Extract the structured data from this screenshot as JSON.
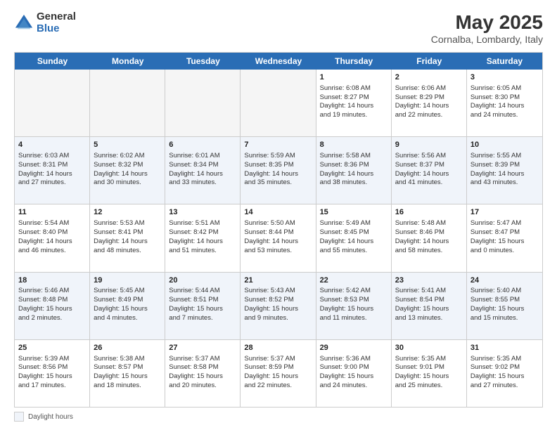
{
  "logo": {
    "general": "General",
    "blue": "Blue"
  },
  "title": "May 2025",
  "subtitle": "Cornalba, Lombardy, Italy",
  "days_of_week": [
    "Sunday",
    "Monday",
    "Tuesday",
    "Wednesday",
    "Thursday",
    "Friday",
    "Saturday"
  ],
  "weeks": [
    [
      {
        "day": "",
        "info": "",
        "empty": true
      },
      {
        "day": "",
        "info": "",
        "empty": true
      },
      {
        "day": "",
        "info": "",
        "empty": true
      },
      {
        "day": "",
        "info": "",
        "empty": true
      },
      {
        "day": "1",
        "info": "Sunrise: 6:08 AM\nSunset: 8:27 PM\nDaylight: 14 hours\nand 19 minutes.",
        "empty": false
      },
      {
        "day": "2",
        "info": "Sunrise: 6:06 AM\nSunset: 8:29 PM\nDaylight: 14 hours\nand 22 minutes.",
        "empty": false
      },
      {
        "day": "3",
        "info": "Sunrise: 6:05 AM\nSunset: 8:30 PM\nDaylight: 14 hours\nand 24 minutes.",
        "empty": false
      }
    ],
    [
      {
        "day": "4",
        "info": "Sunrise: 6:03 AM\nSunset: 8:31 PM\nDaylight: 14 hours\nand 27 minutes.",
        "empty": false
      },
      {
        "day": "5",
        "info": "Sunrise: 6:02 AM\nSunset: 8:32 PM\nDaylight: 14 hours\nand 30 minutes.",
        "empty": false
      },
      {
        "day": "6",
        "info": "Sunrise: 6:01 AM\nSunset: 8:34 PM\nDaylight: 14 hours\nand 33 minutes.",
        "empty": false
      },
      {
        "day": "7",
        "info": "Sunrise: 5:59 AM\nSunset: 8:35 PM\nDaylight: 14 hours\nand 35 minutes.",
        "empty": false
      },
      {
        "day": "8",
        "info": "Sunrise: 5:58 AM\nSunset: 8:36 PM\nDaylight: 14 hours\nand 38 minutes.",
        "empty": false
      },
      {
        "day": "9",
        "info": "Sunrise: 5:56 AM\nSunset: 8:37 PM\nDaylight: 14 hours\nand 41 minutes.",
        "empty": false
      },
      {
        "day": "10",
        "info": "Sunrise: 5:55 AM\nSunset: 8:39 PM\nDaylight: 14 hours\nand 43 minutes.",
        "empty": false
      }
    ],
    [
      {
        "day": "11",
        "info": "Sunrise: 5:54 AM\nSunset: 8:40 PM\nDaylight: 14 hours\nand 46 minutes.",
        "empty": false
      },
      {
        "day": "12",
        "info": "Sunrise: 5:53 AM\nSunset: 8:41 PM\nDaylight: 14 hours\nand 48 minutes.",
        "empty": false
      },
      {
        "day": "13",
        "info": "Sunrise: 5:51 AM\nSunset: 8:42 PM\nDaylight: 14 hours\nand 51 minutes.",
        "empty": false
      },
      {
        "day": "14",
        "info": "Sunrise: 5:50 AM\nSunset: 8:44 PM\nDaylight: 14 hours\nand 53 minutes.",
        "empty": false
      },
      {
        "day": "15",
        "info": "Sunrise: 5:49 AM\nSunset: 8:45 PM\nDaylight: 14 hours\nand 55 minutes.",
        "empty": false
      },
      {
        "day": "16",
        "info": "Sunrise: 5:48 AM\nSunset: 8:46 PM\nDaylight: 14 hours\nand 58 minutes.",
        "empty": false
      },
      {
        "day": "17",
        "info": "Sunrise: 5:47 AM\nSunset: 8:47 PM\nDaylight: 15 hours\nand 0 minutes.",
        "empty": false
      }
    ],
    [
      {
        "day": "18",
        "info": "Sunrise: 5:46 AM\nSunset: 8:48 PM\nDaylight: 15 hours\nand 2 minutes.",
        "empty": false
      },
      {
        "day": "19",
        "info": "Sunrise: 5:45 AM\nSunset: 8:49 PM\nDaylight: 15 hours\nand 4 minutes.",
        "empty": false
      },
      {
        "day": "20",
        "info": "Sunrise: 5:44 AM\nSunset: 8:51 PM\nDaylight: 15 hours\nand 7 minutes.",
        "empty": false
      },
      {
        "day": "21",
        "info": "Sunrise: 5:43 AM\nSunset: 8:52 PM\nDaylight: 15 hours\nand 9 minutes.",
        "empty": false
      },
      {
        "day": "22",
        "info": "Sunrise: 5:42 AM\nSunset: 8:53 PM\nDaylight: 15 hours\nand 11 minutes.",
        "empty": false
      },
      {
        "day": "23",
        "info": "Sunrise: 5:41 AM\nSunset: 8:54 PM\nDaylight: 15 hours\nand 13 minutes.",
        "empty": false
      },
      {
        "day": "24",
        "info": "Sunrise: 5:40 AM\nSunset: 8:55 PM\nDaylight: 15 hours\nand 15 minutes.",
        "empty": false
      }
    ],
    [
      {
        "day": "25",
        "info": "Sunrise: 5:39 AM\nSunset: 8:56 PM\nDaylight: 15 hours\nand 17 minutes.",
        "empty": false
      },
      {
        "day": "26",
        "info": "Sunrise: 5:38 AM\nSunset: 8:57 PM\nDaylight: 15 hours\nand 18 minutes.",
        "empty": false
      },
      {
        "day": "27",
        "info": "Sunrise: 5:37 AM\nSunset: 8:58 PM\nDaylight: 15 hours\nand 20 minutes.",
        "empty": false
      },
      {
        "day": "28",
        "info": "Sunrise: 5:37 AM\nSunset: 8:59 PM\nDaylight: 15 hours\nand 22 minutes.",
        "empty": false
      },
      {
        "day": "29",
        "info": "Sunrise: 5:36 AM\nSunset: 9:00 PM\nDaylight: 15 hours\nand 24 minutes.",
        "empty": false
      },
      {
        "day": "30",
        "info": "Sunrise: 5:35 AM\nSunset: 9:01 PM\nDaylight: 15 hours\nand 25 minutes.",
        "empty": false
      },
      {
        "day": "31",
        "info": "Sunrise: 5:35 AM\nSunset: 9:02 PM\nDaylight: 15 hours\nand 27 minutes.",
        "empty": false
      }
    ]
  ],
  "legend": {
    "box_label": "Daylight hours"
  }
}
